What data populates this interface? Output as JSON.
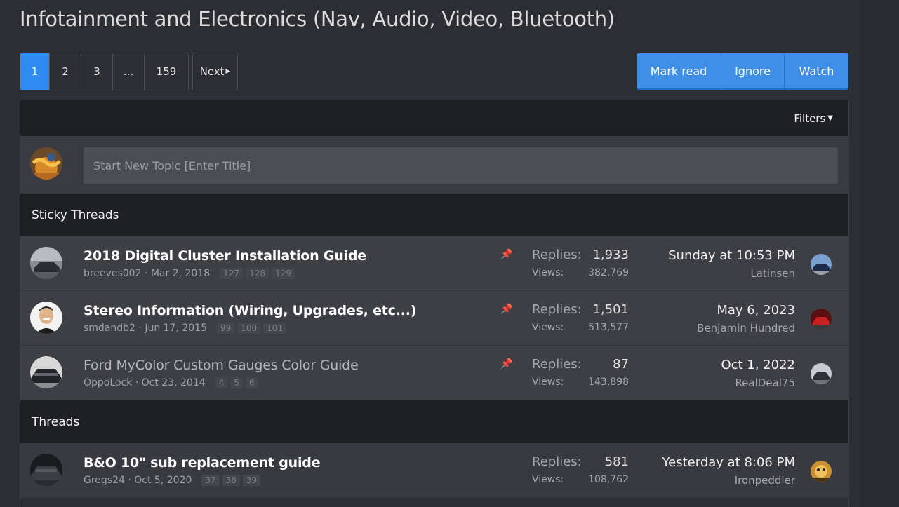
{
  "page": {
    "title": "Infotainment and Electronics (Nav, Audio, Video, Bluetooth)"
  },
  "pagination": {
    "pages": [
      "1",
      "2",
      "3",
      "…",
      "159"
    ],
    "active": "1",
    "next_label": "Next"
  },
  "actions": {
    "mark_read": "Mark read",
    "ignore": "Ignore",
    "watch": "Watch"
  },
  "filters": {
    "label": "Filters"
  },
  "new_topic": {
    "placeholder": "Start New Topic [Enter Title]"
  },
  "sticky_header": "Sticky Threads",
  "threads_header": "Threads",
  "stats_labels": {
    "replies": "Replies:",
    "views": "Views:"
  },
  "sticky_threads": [
    {
      "title": "2018 Digital Cluster Installation Guide",
      "author": "breeves002",
      "date": "Mar 2, 2018",
      "pages": [
        "127",
        "128",
        "129"
      ],
      "replies": "1,933",
      "views": "382,769",
      "last_date": "Sunday at 10:53 PM",
      "last_user": "Latinsen",
      "read": false
    },
    {
      "title": "Stereo Information (Wiring, Upgrades, etc...)",
      "author": "smdandb2",
      "date": "Jun 17, 2015",
      "pages": [
        "99",
        "100",
        "101"
      ],
      "replies": "1,501",
      "views": "513,577",
      "last_date": "May 6, 2023",
      "last_user": "Benjamin Hundred",
      "read": false
    },
    {
      "title": "Ford MyColor Custom Gauges Color Guide",
      "author": "OppoLock",
      "date": "Oct 23, 2014",
      "pages": [
        "4",
        "5",
        "6"
      ],
      "replies": "87",
      "views": "143,898",
      "last_date": "Oct 1, 2022",
      "last_user": "RealDeal75",
      "read": true
    }
  ],
  "threads": [
    {
      "title": "B&O 10\" sub replacement guide",
      "author": "Gregs24",
      "date": "Oct 5, 2020",
      "pages": [
        "37",
        "38",
        "39"
      ],
      "replies": "581",
      "views": "108,762",
      "last_date": "Yesterday at 8:06 PM",
      "last_user": "Ironpeddler",
      "read": false
    }
  ],
  "colors": {
    "accent": "#2f8bf2",
    "button": "#3f8fe6",
    "pin": "#d34747"
  },
  "icons": {
    "pin": "pin-icon",
    "next": "chevron-right-icon",
    "filters": "caret-down-icon"
  }
}
